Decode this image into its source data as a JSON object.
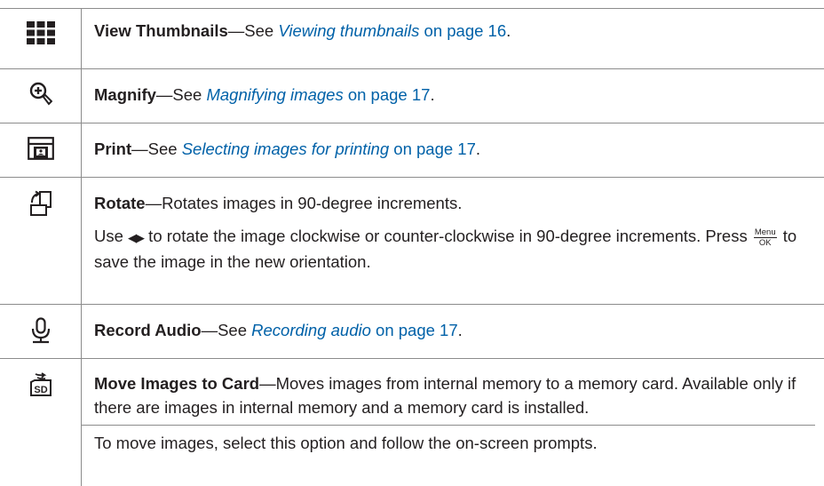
{
  "rows": [
    {
      "icon": "thumbnails-grid-icon",
      "title": "View Thumbnails",
      "dash": "—See ",
      "link": "Viewing thumbnails",
      "suffix": " on page 16",
      "end": "."
    },
    {
      "icon": "magnify-icon",
      "title": "Magnify",
      "dash": "—See ",
      "link": "Magnifying images",
      "suffix": " on page 17",
      "end": "."
    },
    {
      "icon": "print-icon",
      "title": "Print",
      "dash": "—See ",
      "link": "Selecting images for printing",
      "suffix": " on page 17",
      "end": "."
    },
    {
      "icon": "rotate-icon",
      "title": "Rotate",
      "desc": "—Rotates images in 90-degree increments.",
      "para2_part1": "Use ",
      "para2_arrows": "◀▶",
      "para2_part2": " to rotate the image clockwise or counter-clockwise in 90-degree increments. Press ",
      "menu_ok_top": "Menu",
      "menu_ok_bottom": "OK",
      "para2_part3": " to save the image in the new orientation."
    },
    {
      "icon": "microphone-icon",
      "title": "Record Audio",
      "dash": "—See ",
      "link": "Recording audio",
      "suffix": " on page 17",
      "end": "."
    },
    {
      "icon": "move-to-sd-card-icon",
      "title": "Move Images to Card",
      "desc": "—Moves images from internal memory to a memory card. Available only if there are images in internal memory and a memory card is installed.",
      "para2": "To move images, select this option and follow the on-screen prompts."
    }
  ],
  "colors": {
    "link": "#0061a8",
    "text": "#231f20",
    "rule": "#8c8c8c"
  }
}
